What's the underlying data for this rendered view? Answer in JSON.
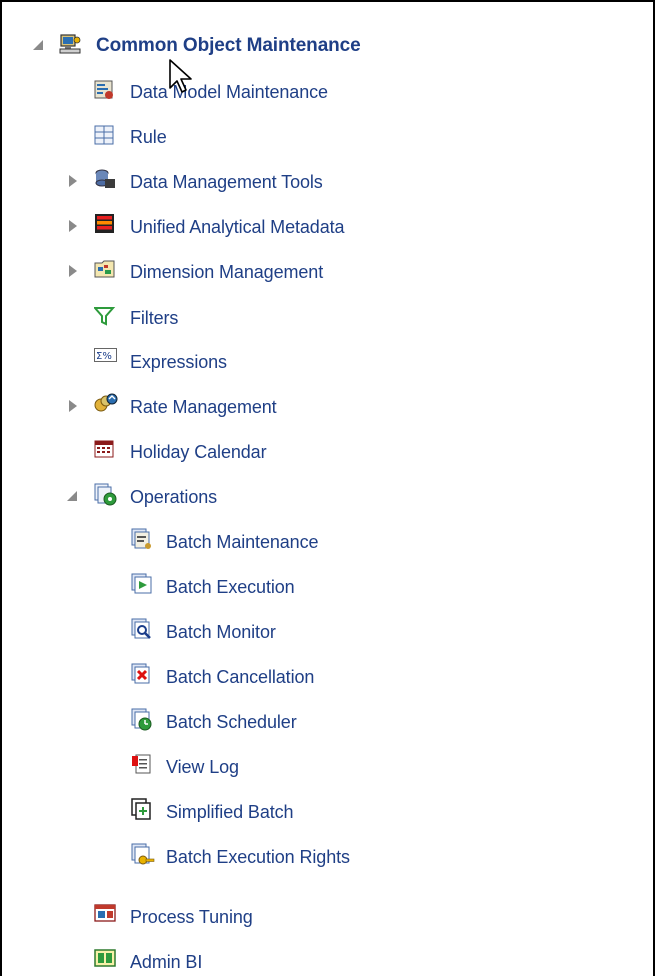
{
  "tree": {
    "root": {
      "label": "Common Object Maintenance",
      "icon": "network-computer-icon",
      "expanded": true
    },
    "items": [
      {
        "label": "Data Model Maintenance",
        "icon": "data-model-icon"
      },
      {
        "label": "Rule",
        "icon": "rule-icon"
      },
      {
        "label": "Data Management Tools",
        "icon": "database-tools-icon",
        "collapsed": true
      },
      {
        "label": "Unified Analytical Metadata",
        "icon": "metadata-icon",
        "collapsed": true
      },
      {
        "label": "Dimension Management",
        "icon": "dimension-icon",
        "collapsed": true
      },
      {
        "label": "Filters",
        "icon": "filter-icon"
      },
      {
        "label": "Expressions",
        "icon": "expression-icon"
      },
      {
        "label": "Rate Management",
        "icon": "rate-icon",
        "collapsed": true
      },
      {
        "label": "Holiday Calendar",
        "icon": "calendar-icon"
      },
      {
        "label": "Operations",
        "icon": "operations-icon",
        "expanded": true
      }
    ],
    "operations_children": [
      {
        "label": "Batch Maintenance",
        "icon": "batch-maintenance-icon"
      },
      {
        "label": "Batch Execution",
        "icon": "batch-execution-icon"
      },
      {
        "label": "Batch Monitor",
        "icon": "batch-monitor-icon"
      },
      {
        "label": "Batch Cancellation",
        "icon": "batch-cancellation-icon"
      },
      {
        "label": "Batch Scheduler",
        "icon": "batch-scheduler-icon"
      },
      {
        "label": "View Log",
        "icon": "view-log-icon"
      },
      {
        "label": "Simplified Batch",
        "icon": "simplified-batch-icon"
      },
      {
        "label": "Batch Execution Rights",
        "icon": "batch-rights-icon"
      }
    ],
    "tail_items": [
      {
        "label": "Process Tuning",
        "icon": "process-tuning-icon"
      },
      {
        "label": "Admin BI",
        "icon": "admin-bi-icon"
      }
    ]
  },
  "colors": {
    "link": "#1f3f86",
    "twisty": "#8a8a8a"
  }
}
